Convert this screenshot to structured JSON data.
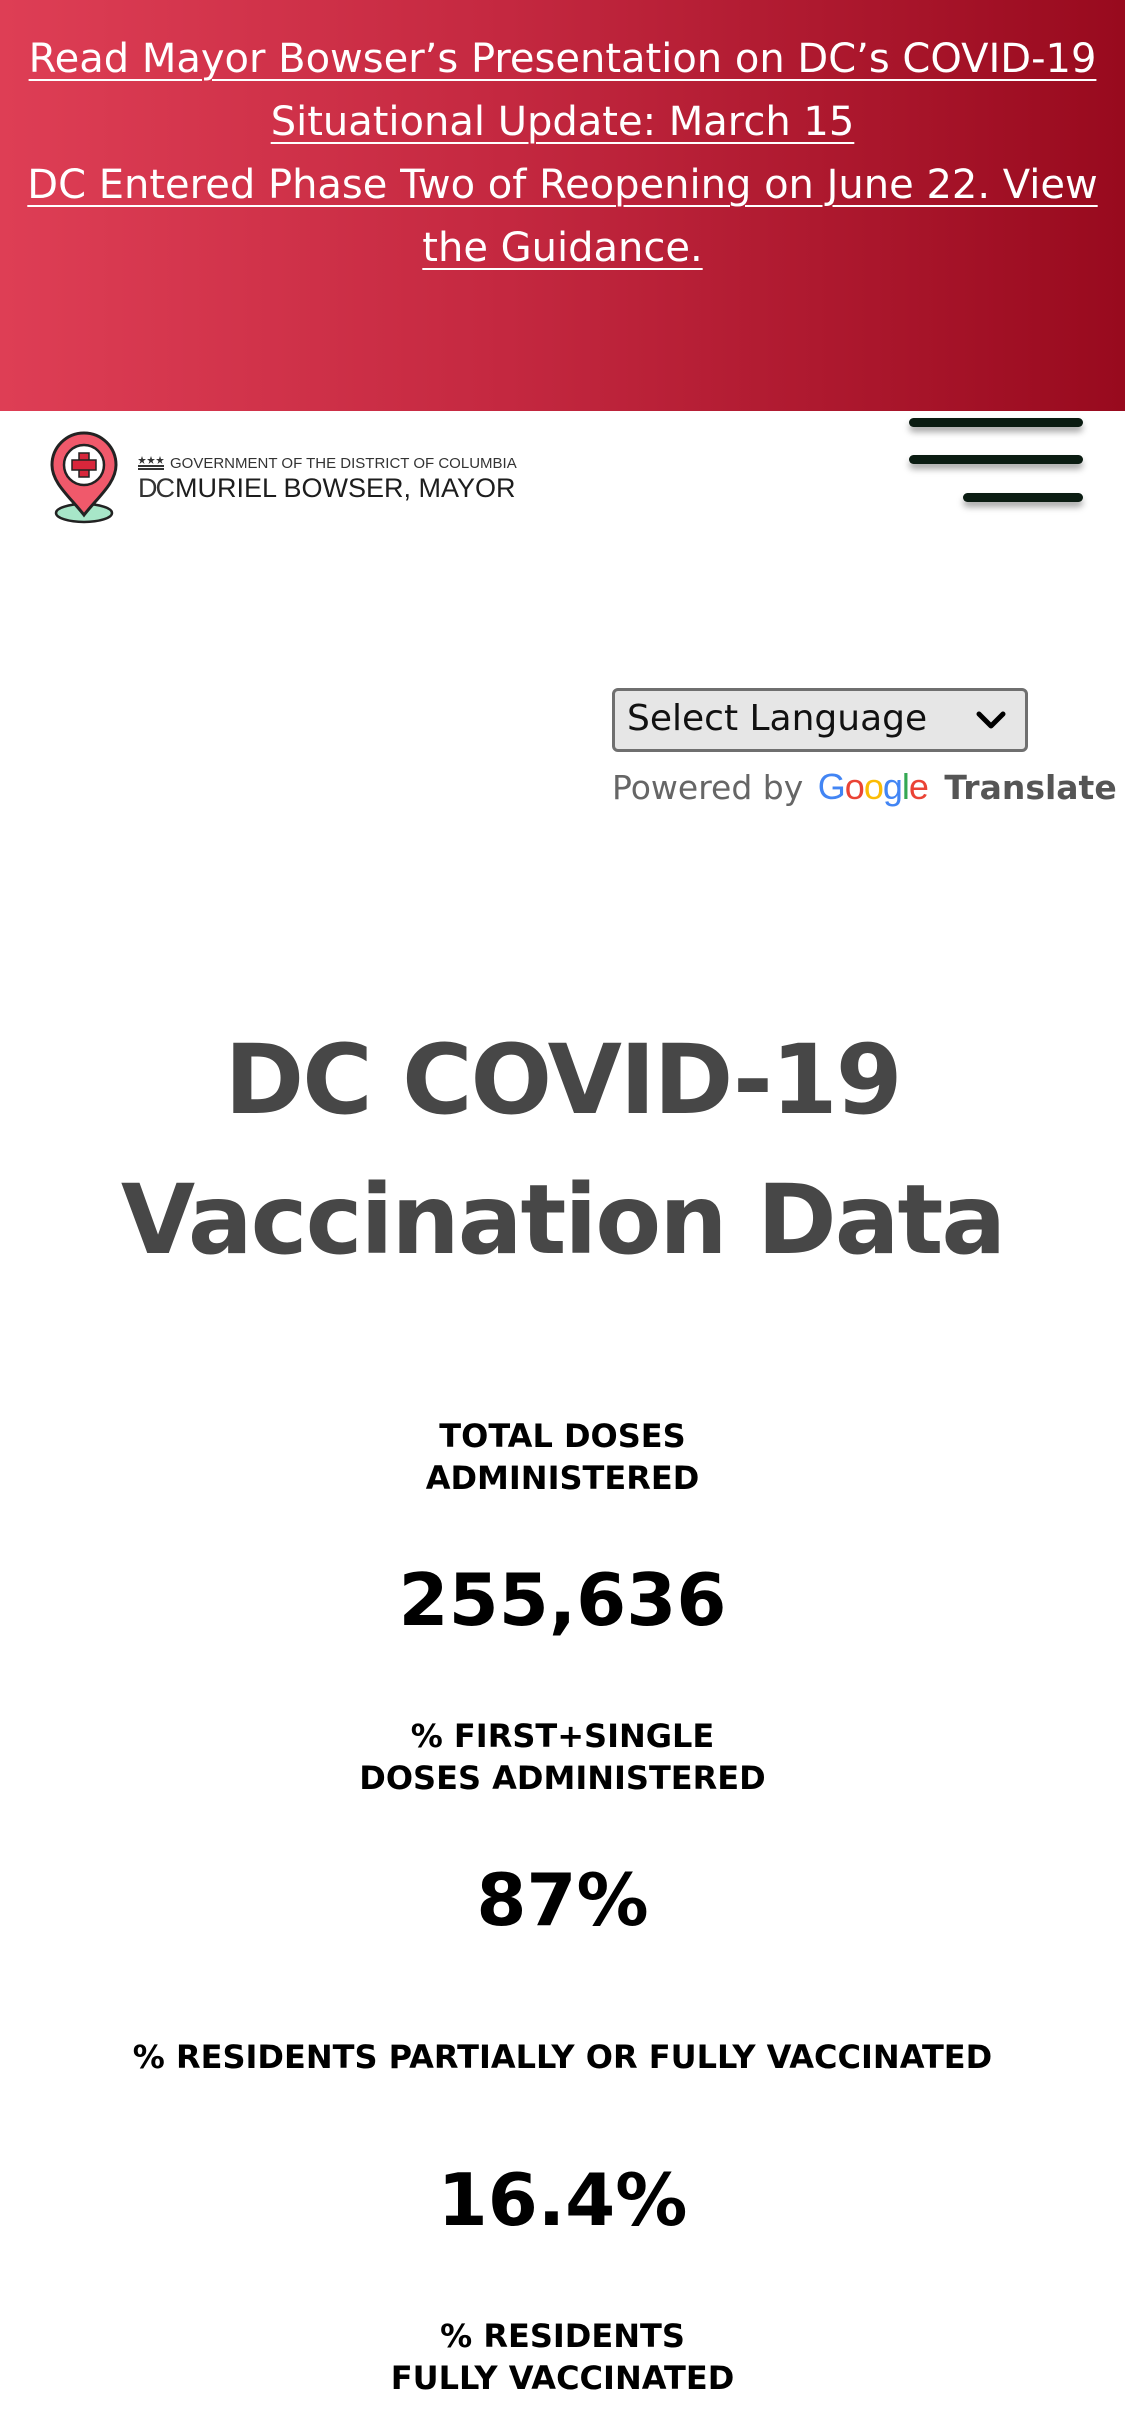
{
  "alert_banner": {
    "links": [
      "Read Mayor Bowser’s Presentation on DC’s COVID-19 Situational Update: March 15",
      "DC Entered Phase Two of Reopening on June 22. View the Guidance."
    ],
    "gradient_colors": [
      "#de3e55",
      "#980a1e"
    ]
  },
  "header": {
    "logo_top_line": "GOVERNMENT OF THE DISTRICT OF COLUMBIA",
    "logo_dc": "DC",
    "logo_mayor": "MURIEL BOWSER, MAYOR",
    "menu_icon": "hamburger-menu-icon",
    "pin_icon": "medical-cross-pin-icon"
  },
  "translate": {
    "select_label": "Select Language",
    "powered_by": "Powered by",
    "google": "Google",
    "translate_word": "Translate"
  },
  "page": {
    "title_line1": "DC COVID-19",
    "title_line2": "Vaccination Data"
  },
  "stats": [
    {
      "label_line1": "TOTAL DOSES",
      "label_line2": "ADMINISTERED",
      "value": "255,636"
    },
    {
      "label_line1": "% FIRST+SINGLE",
      "label_line2": "DOSES ADMINISTERED",
      "value": "87%"
    },
    {
      "label_line1": "% RESIDENTS PARTIALLY OR FULLY VACCINATED",
      "label_line2": "",
      "value": "16.4%"
    },
    {
      "label_line1": "% RESIDENTS",
      "label_line2": "FULLY VACCINATED",
      "value": ""
    }
  ]
}
